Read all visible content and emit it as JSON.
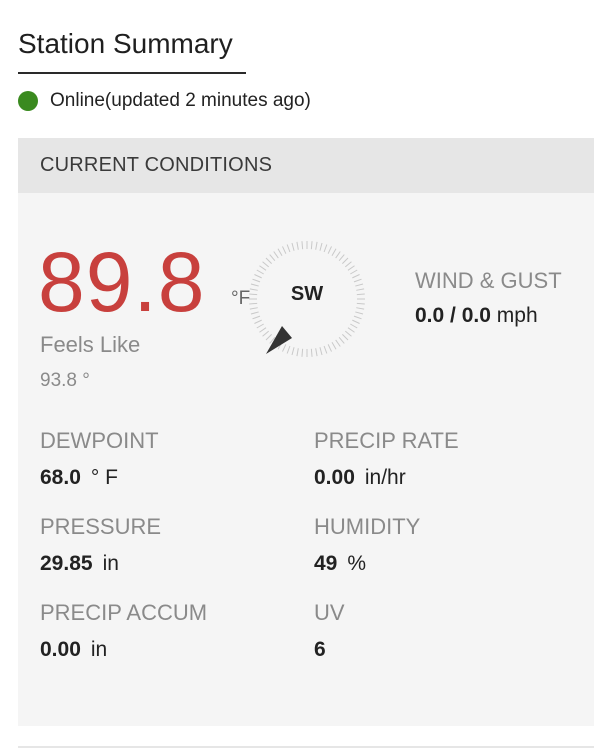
{
  "page": {
    "title": "Station Summary"
  },
  "status": {
    "text": "Online(updated 2 minutes ago)",
    "color": "#3a8a1f",
    "icon": "status-dot-icon"
  },
  "conditions": {
    "header": "CURRENT CONDITIONS",
    "temperature": {
      "value": "89.8",
      "unit": "°F",
      "color": "#c8403d"
    },
    "feels_like": {
      "label": "Feels Like",
      "value": "93.8 °"
    },
    "wind": {
      "direction": "SW",
      "label": "WIND & GUST",
      "speed": "0.0",
      "separator": " / ",
      "gust": "0.0",
      "unit": "mph"
    },
    "metrics": {
      "dewpoint": {
        "label": "DEWPOINT",
        "value": "68.0",
        "unit": "° F"
      },
      "precip_rate": {
        "label": "PRECIP RATE",
        "value": "0.00",
        "unit": "in/hr"
      },
      "pressure": {
        "label": "PRESSURE",
        "value": "29.85",
        "unit": "in"
      },
      "humidity": {
        "label": "HUMIDITY",
        "value": "49",
        "unit": "%"
      },
      "precip_accum": {
        "label": "PRECIP ACCUM",
        "value": "0.00",
        "unit": "in"
      },
      "uv": {
        "label": "UV",
        "value": "6",
        "unit": ""
      }
    }
  }
}
